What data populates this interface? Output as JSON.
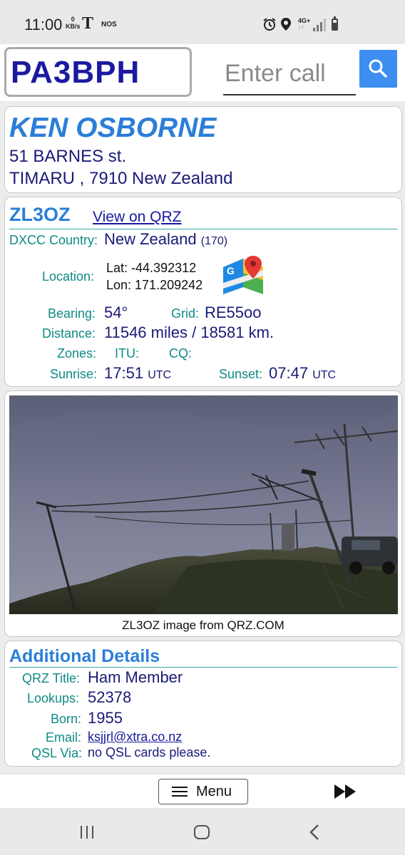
{
  "status_bar": {
    "time": "11:00",
    "data_rate_value": "0",
    "data_rate_unit": "KB/s",
    "app_icon_1": "T",
    "app_icon_2": "NOS",
    "network_top": "4G+",
    "network_bottom": "↓↑",
    "icons": [
      "alarm-icon",
      "location-icon",
      "signal-icon",
      "battery-icon"
    ]
  },
  "header": {
    "my_callsign": "PA3BPH",
    "call_input_value": "",
    "call_input_placeholder": "Enter call",
    "search_icon": "search-icon",
    "accent_color": "#3d8ef0"
  },
  "contact": {
    "name": "KEN OSBORNE",
    "address_line1": "51 BARNES st.",
    "address_line2": "TIMARU , 7910 New Zealand"
  },
  "station": {
    "callsign": "ZL3OZ",
    "qrz_link": "View on QRZ",
    "dxcc_label": "DXCC Country:",
    "dxcc_country": "New Zealand",
    "dxcc_code": "(170)",
    "location_label": "Location:",
    "lat": "Lat: -44.392312",
    "lon": "Lon: 171.209242",
    "bearing_label": "Bearing:",
    "bearing": "54°",
    "grid_label": "Grid:",
    "grid": "RE55oo",
    "distance_label": "Distance:",
    "distance": "11546 miles / 18581 km.",
    "zones_label": "Zones:",
    "itu_label": "ITU:",
    "cq_label": "CQ:",
    "sunrise_label": "Sunrise:",
    "sunrise": "17:51",
    "sunrise_tz": "UTC",
    "sunset_label": "Sunset:",
    "sunset": "07:47",
    "sunset_tz": "UTC",
    "map_icon": "google-maps-icon"
  },
  "photo": {
    "caption": "ZL3OZ image from QRZ.COM"
  },
  "details": {
    "heading": "Additional Details",
    "qrz_title_label": "QRZ Title:",
    "qrz_title": "Ham Member",
    "lookups_label": "Lookups:",
    "lookups": "52378",
    "born_label": "Born:",
    "born": "1955",
    "email_label": "Email:",
    "email": "ksjjrl@xtra.co.nz",
    "qsl_label": "QSL Via:",
    "qsl": "no QSL cards please."
  },
  "toolbar": {
    "menu_label": "Menu",
    "forward_icon": "fast-forward-icon"
  },
  "nav": {
    "icons": [
      "recent-apps-icon",
      "home-icon",
      "back-icon"
    ]
  },
  "colors": {
    "heading_blue": "#2b7ed8",
    "value_navy": "#1a1a78",
    "label_teal": "#0e8a84"
  }
}
